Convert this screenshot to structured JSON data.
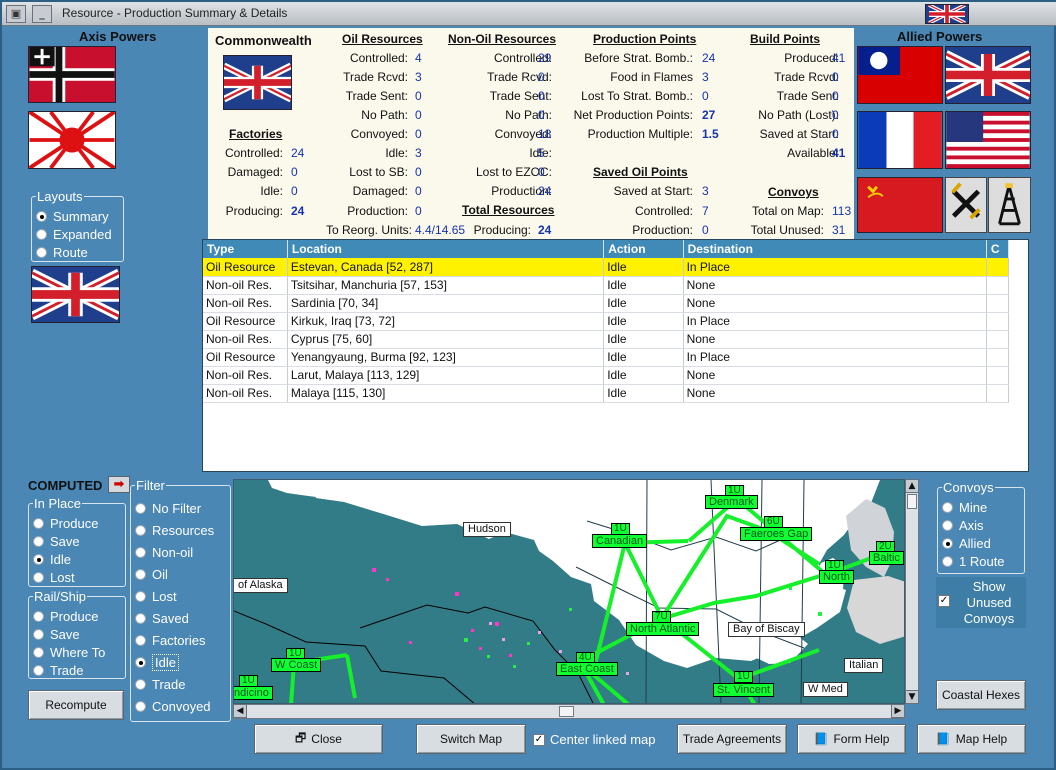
{
  "window": {
    "title": "Resource - Production Summary & Details"
  },
  "axis_title": "Axis Powers",
  "allied_title": "Allied Powers",
  "nation": "Commonwealth",
  "layouts": {
    "legend": "Layouts",
    "items": [
      "Summary",
      "Expanded",
      "Route"
    ],
    "selected": "Summary"
  },
  "summary": {
    "factories": {
      "heading": "Factories",
      "rows": [
        [
          "Controlled:",
          "24"
        ],
        [
          "Damaged:",
          "0"
        ],
        [
          "Idle:",
          "0"
        ],
        [
          "Producing:",
          "24"
        ]
      ]
    },
    "oil": {
      "heading": "Oil Resources",
      "rows": [
        [
          "Controlled:",
          "4"
        ],
        [
          "Trade Rcvd:",
          "3"
        ],
        [
          "Trade Sent:",
          "0"
        ],
        [
          "No Path:",
          "0"
        ],
        [
          "Convoyed:",
          "0"
        ],
        [
          "Idle:",
          "3"
        ],
        [
          "Lost to SB:",
          "0"
        ],
        [
          "Damaged:",
          "0"
        ],
        [
          "Production:",
          "0"
        ],
        [
          "To Reorg. Units:",
          "4.4/14.65"
        ]
      ]
    },
    "nonoil": {
      "heading": "Non-Oil Resources",
      "rows": [
        [
          "Controlled:",
          "29"
        ],
        [
          "Trade Rcvd:",
          "0"
        ],
        [
          "Trade Sent:",
          "0"
        ],
        [
          "No Path:",
          "0"
        ],
        [
          "Convoyed:",
          "18"
        ],
        [
          "Idle:",
          "5"
        ],
        [
          "Lost to EZOC:",
          "0"
        ],
        [
          "Production:",
          "24"
        ]
      ]
    },
    "total": {
      "heading": "Total Resources",
      "label": "Producing:",
      "value": "24"
    },
    "production": {
      "heading": "Production Points",
      "rows": [
        [
          "Before Strat. Bomb.:",
          "24"
        ],
        [
          "Food in Flames",
          "3"
        ],
        [
          "Lost To Strat. Bomb.:",
          "0"
        ],
        [
          "Net Production Points:",
          "27"
        ],
        [
          "Production Multiple:",
          "1.5"
        ]
      ]
    },
    "saved": {
      "heading": "Saved Oil Points",
      "rows": [
        [
          "Saved at Start:",
          "3"
        ],
        [
          "Controlled:",
          "7"
        ],
        [
          "Production:",
          "0"
        ]
      ]
    },
    "build": {
      "heading": "Build Points",
      "rows": [
        [
          "Produced:",
          "41"
        ],
        [
          "Trade Rcvd:",
          "0"
        ],
        [
          "Trade Sent:",
          "0"
        ],
        [
          "No Path (Lost):",
          "0"
        ],
        [
          "Saved at Start:",
          "0"
        ],
        [
          "Available:",
          "41"
        ]
      ]
    },
    "convoys": {
      "heading": "Convoys",
      "rows": [
        [
          "Total on Map:",
          "113"
        ],
        [
          "Total Unused:",
          "31"
        ]
      ]
    }
  },
  "table": {
    "columns": [
      "Type",
      "Location",
      "Action",
      "Destination",
      "C"
    ],
    "rows": [
      [
        "Oil Resource",
        "Estevan, Canada [52, 287]",
        "Idle",
        "In Place"
      ],
      [
        "Non-oil Res.",
        "Tsitsihar, Manchuria [57, 153]",
        "Idle",
        "None"
      ],
      [
        "Non-oil Res.",
        "Sardinia [70, 34]",
        "Idle",
        "None"
      ],
      [
        "Oil Resource",
        "Kirkuk, Iraq [73, 72]",
        "Idle",
        "In Place"
      ],
      [
        "Non-oil Res.",
        "Cyprus [75, 60]",
        "Idle",
        "None"
      ],
      [
        "Oil Resource",
        "Yenangyaung, Burma [92, 123]",
        "Idle",
        "In Place"
      ],
      [
        "Non-oil Res.",
        "Larut, Malaya [113, 129]",
        "Idle",
        "None"
      ],
      [
        "Non-oil Res.",
        "Malaya [115, 130]",
        "Idle",
        "None"
      ]
    ]
  },
  "computed": {
    "label": "COMPUTED",
    "arrow": "➡"
  },
  "inplace": {
    "legend": "In Place",
    "items": [
      "Produce",
      "Save",
      "Idle",
      "Lost"
    ],
    "selected": "Idle"
  },
  "railship": {
    "legend": "Rail/Ship",
    "items": [
      "Produce",
      "Save",
      "Where To",
      "Trade"
    ]
  },
  "filter": {
    "legend": "Filter",
    "items": [
      "No Filter",
      "Resources",
      "Non-oil",
      "Oil",
      "Lost",
      "Saved",
      "Factories",
      "Idle",
      "Trade",
      "Convoyed"
    ],
    "selected": "Idle"
  },
  "convoys_panel": {
    "legend": "Convoys",
    "items": [
      "Mine",
      "Axis",
      "Allied",
      "1 Route"
    ],
    "selected": "Allied",
    "show_unused": "Show Unused Convoys",
    "checked": true
  },
  "buttons": {
    "recompute": "Recompute",
    "close": "Close",
    "switch_map": "Switch Map",
    "center_linked": "Center linked map",
    "trade_agreements": "Trade Agreements",
    "form_help": "Form Help",
    "map_help": "Map Help",
    "coastal_hexes": "Coastal Hexes"
  },
  "map": {
    "labels": [
      "Hudson",
      "of Alaska",
      "Bay of Biscay",
      "W Med",
      "Italian"
    ],
    "routes": [
      "Denmark",
      "Canadian",
      "Faeroes Gap",
      "Baltic",
      "North",
      "North Atlantic",
      "East Coast",
      "W Coast",
      "St. Vincent",
      "ndicino"
    ],
    "units": [
      "1U",
      "1U",
      "6U",
      "2U",
      "1U",
      "7U",
      "4U",
      "1U",
      "1U",
      "1U"
    ]
  },
  "colors": {
    "accent": "#4a87b4",
    "selection": "#fff200",
    "sea": "#2f7889",
    "route": "#18f02e"
  }
}
